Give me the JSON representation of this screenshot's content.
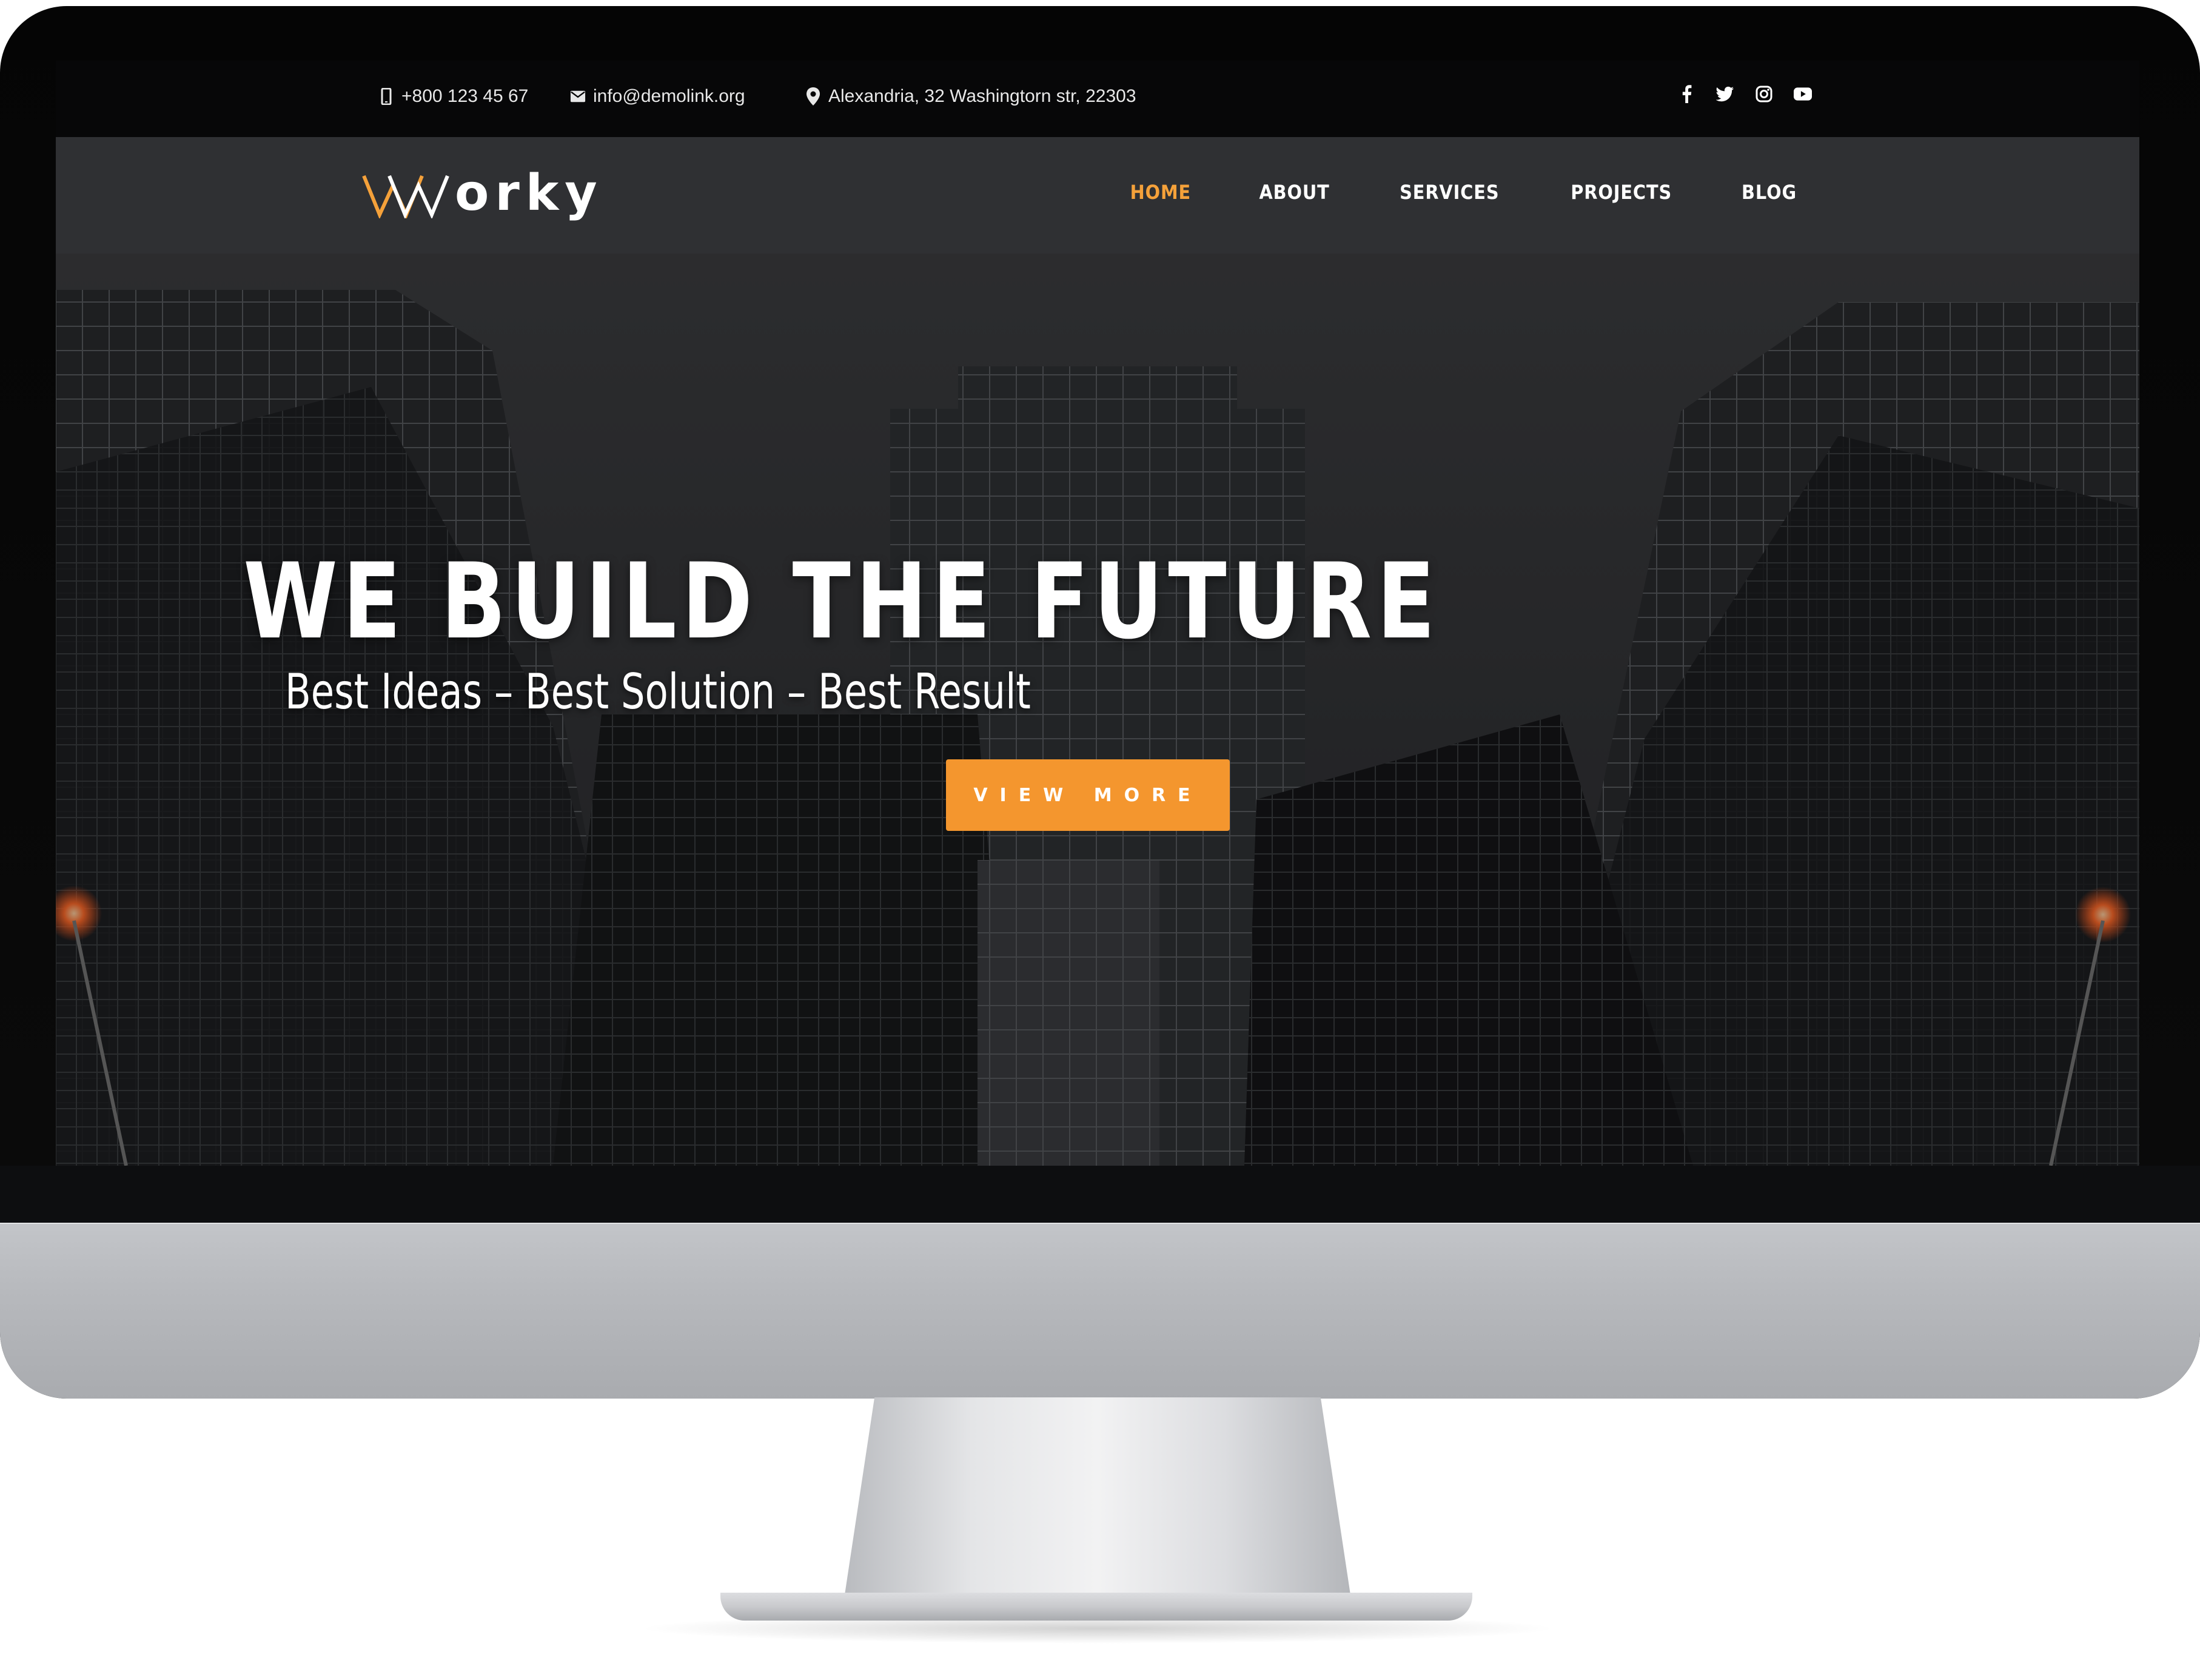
{
  "topbar": {
    "phone": "+800 123 45 67",
    "email": "info@demolink.org",
    "address": "Alexandria, 32 Washingtorn str, 22303",
    "icons": {
      "phone": "mobile-phone-icon",
      "email": "envelope-icon",
      "address": "map-pin-icon"
    },
    "social": [
      "facebook-icon",
      "twitter-icon",
      "instagram-icon",
      "youtube-icon"
    ]
  },
  "brand": {
    "logo_text": "orky",
    "logo_mark": "W",
    "accent": "#f5a13a"
  },
  "nav": {
    "items": [
      {
        "label": "HOME",
        "active": true
      },
      {
        "label": "ABOUT",
        "active": false
      },
      {
        "label": "SERVICES",
        "active": false
      },
      {
        "label": "PROJECTS",
        "active": false
      },
      {
        "label": "BLOG",
        "active": false
      }
    ]
  },
  "hero": {
    "title": "WE BUILD THE FUTURE",
    "subtitle": "Best Ideas – Best Solution – Best Result",
    "button_label": "VIEW MORE",
    "button_color": "#f4962e"
  }
}
